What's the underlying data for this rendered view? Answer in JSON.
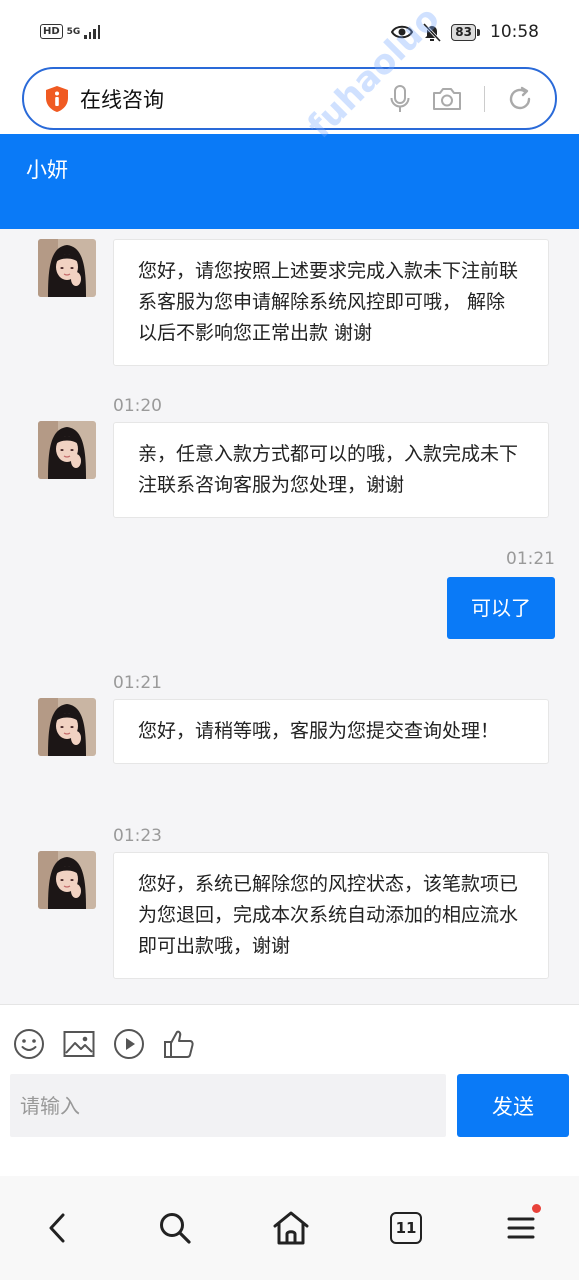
{
  "status_bar": {
    "hd": "HD",
    "network": "5G",
    "battery": "83",
    "time": "10:58"
  },
  "browser": {
    "url_text": "在线咨询",
    "shield_icon": "shield-info-icon",
    "mic_icon": "microphone-icon",
    "camera_icon": "camera-icon",
    "refresh_icon": "refresh-icon"
  },
  "chat": {
    "title": "小妍",
    "messages": [
      {
        "direction": "in",
        "time": "",
        "text": "您好，请您按照上述要求完成入款未下注前联系客服为您申请解除系统风控即可哦， 解除以后不影响您正常出款 谢谢"
      },
      {
        "direction": "in",
        "time": "01:20",
        "text": "亲，任意入款方式都可以的哦，入款完成未下注联系咨询客服为您处理，谢谢"
      },
      {
        "direction": "out",
        "time": "01:21",
        "text": "可以了"
      },
      {
        "direction": "in",
        "time": "01:21",
        "text": "您好，请稍等哦，客服为您提交查询处理！"
      },
      {
        "direction": "in",
        "time": "01:23",
        "text": "您好，系统已解除您的风控状态，该笔款项已为您退回，完成本次系统自动添加的相应流水即可出款哦，谢谢"
      }
    ]
  },
  "input": {
    "placeholder": "请输入",
    "send_label": "发送",
    "tools": [
      "emoji-icon",
      "image-icon",
      "play-icon",
      "thumbs-up-icon"
    ]
  },
  "nav": {
    "tab_count": "11",
    "items": [
      "back-icon",
      "search-icon",
      "home-icon",
      "tabs-icon",
      "menu-icon"
    ]
  },
  "watermark": "fuhaoluo",
  "colors": {
    "accent": "#0a7af7",
    "url_border": "#2a6ad8",
    "notification_dot": "#e8423a"
  }
}
